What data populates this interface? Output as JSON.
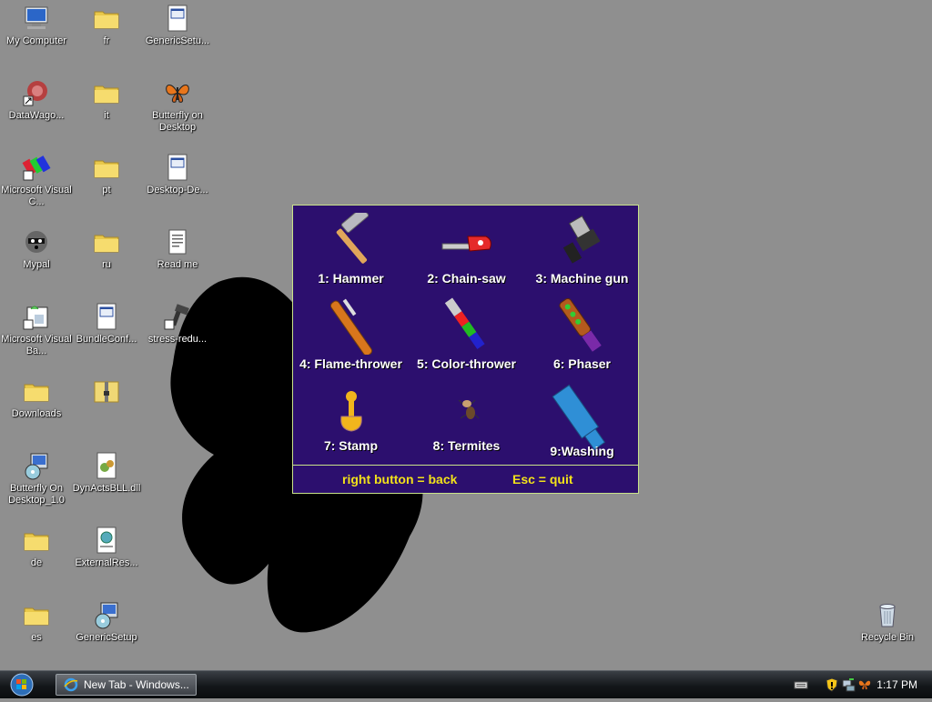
{
  "desktop": {
    "icons": [
      {
        "label": "My Computer",
        "icon": "computer-icon"
      },
      {
        "label": "fr",
        "icon": "folder-icon"
      },
      {
        "label": "GenericSetu...",
        "icon": "app-window-icon"
      },
      {
        "label": "DataWago...",
        "icon": "datawagon-shortcut-icon"
      },
      {
        "label": "it",
        "icon": "folder-icon"
      },
      {
        "label": "Butterfly on Desktop",
        "icon": "butterfly-icon"
      },
      {
        "label": "Microsoft Visual C...",
        "icon": "visual-c-icon"
      },
      {
        "label": "pt",
        "icon": "folder-icon"
      },
      {
        "label": "Desktop-De...",
        "icon": "app-window-icon"
      },
      {
        "label": "Mypal",
        "icon": "raccoon-icon"
      },
      {
        "label": "ru",
        "icon": "folder-icon"
      },
      {
        "label": "Read me",
        "icon": "text-document-icon"
      },
      {
        "label": "Microsoft Visual Ba...",
        "icon": "visual-basic-icon"
      },
      {
        "label": "BundleConf...",
        "icon": "app-window-icon"
      },
      {
        "label": "stress-redu...",
        "icon": "tool-shortcut-icon"
      },
      {
        "label": "Downloads",
        "icon": "folder-icon"
      },
      {
        "label": "",
        "icon": "zip-folder-icon"
      },
      {
        "label": "Butterfly On Desktop_1.0",
        "icon": "installer-icon"
      },
      {
        "label": "DynActsBLL.dll",
        "icon": "dll-icon"
      },
      {
        "label": "de",
        "icon": "folder-icon"
      },
      {
        "label": "ExternalRes...",
        "icon": "web-document-icon"
      },
      {
        "label": "es",
        "icon": "folder-icon"
      },
      {
        "label": "GenericSetup",
        "icon": "installer-icon"
      },
      {
        "label": "Recycle Bin",
        "icon": "recycle-bin-icon"
      }
    ]
  },
  "game": {
    "tools": [
      {
        "label": "1: Hammer",
        "icon": "hammer-icon"
      },
      {
        "label": "2: Chain-saw",
        "icon": "chainsaw-icon"
      },
      {
        "label": "3: Machine gun",
        "icon": "machine-gun-icon"
      },
      {
        "label": "4: Flame-thrower",
        "icon": "flamethrower-icon"
      },
      {
        "label": "5: Color-thrower",
        "icon": "color-thrower-icon"
      },
      {
        "label": "6: Phaser",
        "icon": "phaser-icon"
      },
      {
        "label": "7: Stamp",
        "icon": "stamp-icon"
      },
      {
        "label": "8: Termites",
        "icon": "termites-icon"
      },
      {
        "label": "9:Washing",
        "icon": "washing-icon"
      }
    ],
    "footer_back": "right button = back",
    "footer_quit": "Esc = quit"
  },
  "taskbar": {
    "task_label": "New Tab - Windows...",
    "clock": "1:17 PM"
  },
  "colors": {
    "desktop": "#8f8f8f",
    "panel": "#2c0f6e",
    "panel_border": "#c9e38a",
    "footer_text": "#f2e21a"
  }
}
